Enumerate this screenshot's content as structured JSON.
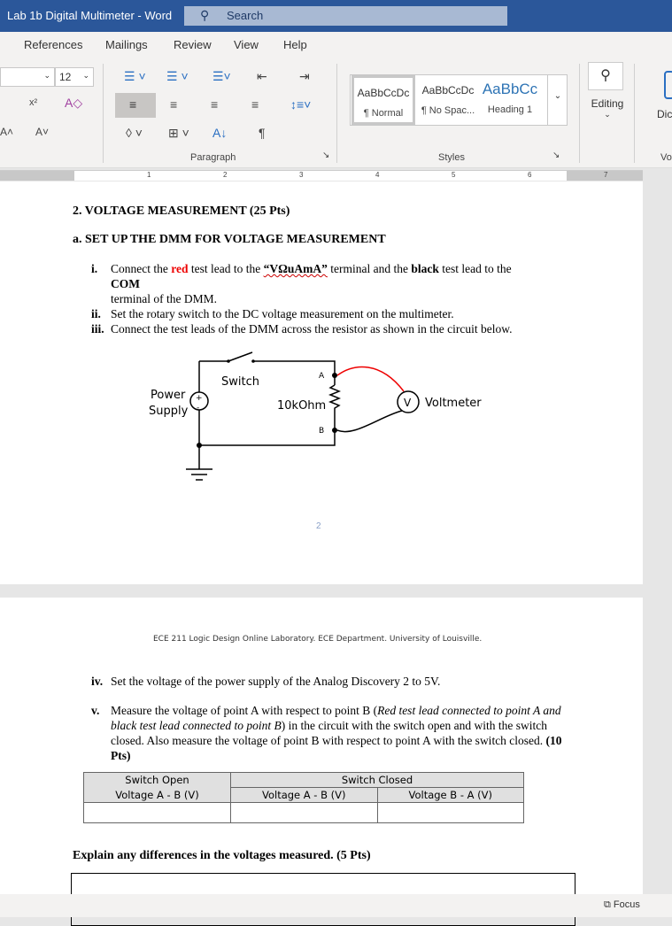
{
  "window": {
    "title": "Lab 1b Digital Multimeter  -  Word",
    "search_placeholder": "Search"
  },
  "tabs": [
    "References",
    "Mailings",
    "Review",
    "View",
    "Help"
  ],
  "ribbon": {
    "font_size": "12",
    "groups": {
      "paragraph": "Paragraph",
      "styles": "Styles",
      "voice": "Vo"
    },
    "styles": [
      {
        "preview": "AaBbCcDc",
        "name": "¶ Normal"
      },
      {
        "preview": "AaBbCcDc",
        "name": "¶ No Spac..."
      },
      {
        "preview": "AaBbCc",
        "name": "Heading 1"
      }
    ],
    "editing": "Editing",
    "dictate": "Dic"
  },
  "ruler": [
    "1",
    "2",
    "3",
    "4",
    "5",
    "6",
    "7"
  ],
  "page1": {
    "heading1": "2. VOLTAGE MEASUREMENT (25 Pts)",
    "heading2": "a. SET UP THE DMM FOR VOLTAGE MEASUREMENT",
    "items": [
      {
        "num": "i.",
        "pre": "Connect the ",
        "red": "red",
        "mid": " test lead to the ",
        "terminal": "“VΩuAmA”",
        "mid2": " terminal and the ",
        "black": "black",
        "post": " test lead to the ",
        "com": "COM",
        "tail": "terminal of the DMM."
      },
      {
        "num": "ii.",
        "text": "Set the rotary switch to the DC voltage measurement on the multimeter."
      },
      {
        "num": "iii.",
        "text": "Connect the test leads of the DMM across the resistor as shown in the circuit below."
      }
    ],
    "circuit": {
      "switch": "Switch",
      "power1": "Power",
      "power2": "Supply",
      "resistor": "10kOhm",
      "a": "A",
      "b": "B",
      "voltmeter": "Voltmeter",
      "v": "V",
      "plus": "+",
      "minus": "-"
    },
    "page_number": "2"
  },
  "page2": {
    "header": "ECE 211 Logic Design Online Laboratory.  ECE Department. University of Louisville.",
    "item4": {
      "num": "iv.",
      "text": "Set the voltage of the power supply of the Analog Discovery 2 to 5V."
    },
    "item5": {
      "num": "v.",
      "pre": "Measure the voltage of point A with respect to point B (",
      "italic": "Red test lead connected to point A and black test lead connected to point B",
      "post": ") in the circuit with the switch open and with the switch closed. Also measure the voltage of point B with respect to point A with the switch closed. ",
      "pts": "(10 Pts)"
    },
    "table": {
      "open_header": "Switch Open",
      "closed_header": "Switch Closed",
      "cols": [
        "Voltage A - B (V)",
        "Voltage A - B (V)",
        "Voltage B - A (V)"
      ],
      "values": [
        "",
        "",
        ""
      ]
    },
    "explain": "Explain any differences in the voltages measured. (5 Pts)"
  },
  "status": {
    "focus": "Focus"
  }
}
